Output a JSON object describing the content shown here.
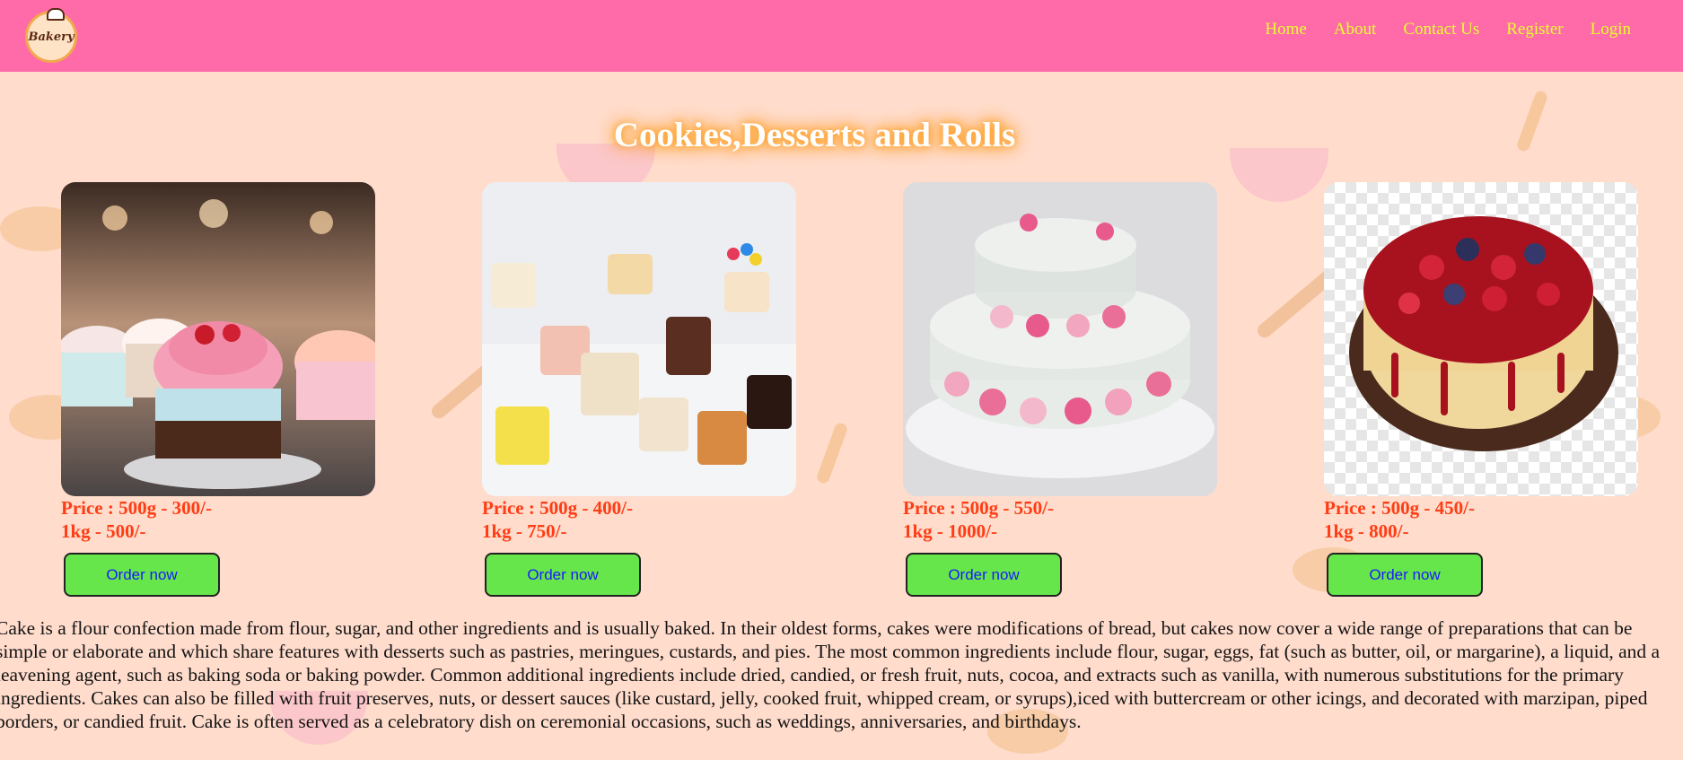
{
  "header": {
    "logo_text": "Bakery",
    "nav": [
      "Home",
      "About",
      "Contact Us",
      "Register",
      "Login"
    ]
  },
  "main": {
    "title": "Cookies,Desserts and Rolls",
    "products": [
      {
        "price_line1": "Price : 500g - 300/-",
        "price_line2": "1kg - 500/-",
        "button": "Order now",
        "image": "cupcakes-image"
      },
      {
        "price_line1": "Price : 500g - 400/-",
        "price_line2": "1kg - 750/-",
        "button": "Order now",
        "image": "assorted-cakes-image"
      },
      {
        "price_line1": "Price : 500g - 550/-",
        "price_line2": "1kg - 1000/-",
        "button": "Order now",
        "image": "rose-cake-image"
      },
      {
        "price_line1": "Price : 500g - 450/-",
        "price_line2": "1kg - 800/-",
        "button": "Order now",
        "image": "berry-cheesecake-image"
      }
    ],
    "description": "Cake is a flour confection made from flour, sugar, and other ingredients and is usually baked. In their oldest forms, cakes were modifications of bread, but cakes now cover a wide range of preparations that can be simple or elaborate and which share features with desserts such as pastries, meringues, custards, and pies. The most common ingredients include flour, sugar, eggs, fat (such as butter, oil, or margarine), a liquid, and a leavening agent, such as baking soda or baking powder. Common additional ingredients include dried, candied, or fresh fruit, nuts, cocoa, and extracts such as vanilla, with numerous substitutions for the primary ingredients. Cakes can also be filled with fruit preserves, nuts, or dessert sauces (like custard, jelly, cooked fruit, whipped cream, or syrups),iced with buttercream or other icings, and decorated with marzipan, piped borders, or candied fruit. Cake is often served as a celebratory dish on ceremonial occasions, such as weddings, anniversaries, and birthdays."
  },
  "colors": {
    "navbar": "#ff6aa8",
    "nav_link": "#e7ff2d",
    "page_bg": "#ffdccc",
    "price": "#ff3d14",
    "button_bg": "#66e64a",
    "button_text": "#1a1aff"
  }
}
